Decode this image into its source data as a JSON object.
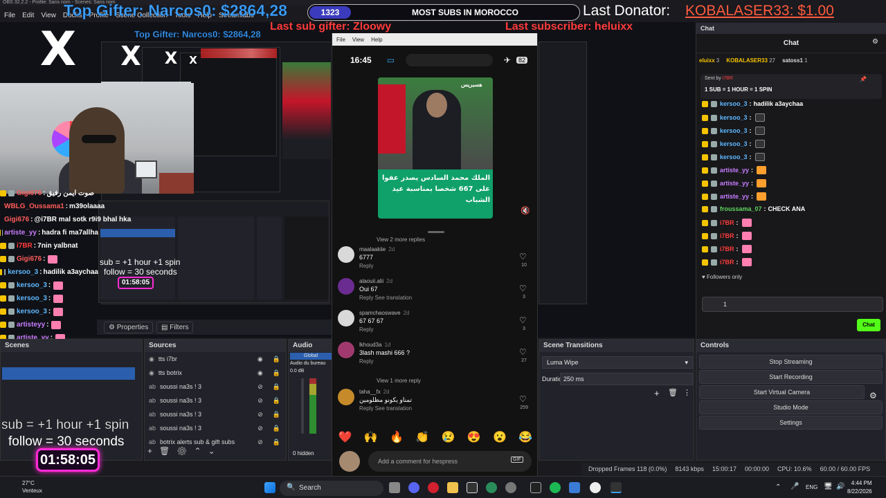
{
  "obs": {
    "window_title": "OBS 32.2.2 - Profile: Sans nom - Scenes: Sans nom",
    "menu": [
      "File",
      "Edit",
      "View",
      "Docks",
      "Profile",
      "Scene Collection",
      "Tools",
      "Help",
      "Streamlabs"
    ]
  },
  "overlay": {
    "top_gifter": "Top Gifter: Narcos0: $2864,28",
    "sub_goal_count": "1323",
    "sub_goal_label": "MOST SUBS IN MOROCCO",
    "last_donator_label": "Last Donator:",
    "last_donator_value": "KOBALASER33: $1.00",
    "last_sub_gifter": "Last sub gifter: Zloowy",
    "last_subscriber": "Last subscriber: heluixx",
    "sub_rule": "sub  = +1 hour +1 spin",
    "follow_rule": "follow = 30 seconds",
    "timer": "01:58:05",
    "logo": "X"
  },
  "left_chat": [
    {
      "user": "Gigi676",
      "text": "صوت ايمن رفيق",
      "color": "#ff5c5c"
    },
    {
      "user": "WBLG_Oussama1",
      "text": "m39olaaaa",
      "color": "#ff5c5c"
    },
    {
      "user": "Gigi676",
      "text": "@i7BR mal sotk r9i9 bhal hka",
      "color": "#ff5c5c"
    },
    {
      "user": "artiste_yy",
      "text": "hadra fi ma7allha",
      "color": "#c97dff"
    },
    {
      "user": "i7BR",
      "text": "7nin yalbnat",
      "color": "#ff3b3b"
    },
    {
      "user": "Gigi676",
      "text": "",
      "color": "#ff5c5c"
    },
    {
      "user": "kersoo_3",
      "text": "hadilik a3aychaa",
      "color": "#5fb8ff"
    },
    {
      "user": "kersoo_3",
      "text": "",
      "color": "#5fb8ff"
    },
    {
      "user": "kersoo_3",
      "text": "",
      "color": "#5fb8ff"
    },
    {
      "user": "kersoo_3",
      "text": "",
      "color": "#5fb8ff"
    },
    {
      "user": "artisteyy",
      "text": "",
      "color": "#c97dff"
    },
    {
      "user": "artiste_yy",
      "text": "",
      "color": "#c97dff"
    },
    {
      "user": "artiste_yy",
      "text": "",
      "color": "#c97dff"
    },
    {
      "user": "froussama_07",
      "text": "CHECK ANA",
      "color": "#5fd35f"
    },
    {
      "user": "i7BR",
      "text": "",
      "color": "#ff3b3b"
    },
    {
      "user": "i7BR",
      "text": "",
      "color": "#ff3b3b"
    },
    {
      "user": "i7BR",
      "text": "",
      "color": "#ff3b3b"
    },
    {
      "user": "i7BR",
      "text": "",
      "color": "#ff3b3b"
    }
  ],
  "docks": {
    "scenes_title": "Scenes",
    "sources_title": "Sources",
    "audio_title": "Audio Mixer",
    "audio_global": "Global",
    "audio_device": "Audio du bureau",
    "audio_db": "0.0 dB",
    "audio_hidden": "0 hidden",
    "transitions_title": "Scene Transitions",
    "transition_value": "Luma Wipe",
    "duration_label": "Duration",
    "duration_value": "250 ms",
    "controls_title": "Controls",
    "properties": "Properties",
    "filters": "Filters",
    "controls": [
      "Stop Streaming",
      "Start Recording",
      "Start Virtual Camera",
      "Studio Mode",
      "Settings"
    ],
    "sources": [
      "tts i7br",
      "tts botrix",
      "soussi na3s ! 3",
      "soussi na3s ! 3",
      "soussi na3s ! 3",
      "soussi na3s ! 3",
      "botrix alerts sub & gift subs"
    ]
  },
  "phone": {
    "menu": [
      "File",
      "View",
      "Help"
    ],
    "time": "16:45",
    "battery": "82",
    "news_logo": "هسبريس",
    "news_caption": "الملك محمد السادس يصدر عفوا على 667 شخصا بمناسبة عيد الشباب",
    "view_more_2": "View 2 more replies",
    "view_more_1": "View 1 more reply",
    "comments": [
      {
        "user": "maalaakiie",
        "age": "2d",
        "text": "6777",
        "meta": "Reply",
        "likes": "10"
      },
      {
        "user": "alaouii.alii",
        "age": "2d",
        "text": "Oui 67",
        "meta": "Reply    See translation",
        "likes": "3"
      },
      {
        "user": "spamchaoswave",
        "age": "2d",
        "text": "67 67 67",
        "meta": "Reply",
        "likes": "3"
      },
      {
        "user": "lkhoud3a",
        "age": "1d",
        "text": "3lash mashi 666 ?",
        "meta": "Reply",
        "likes": "27"
      },
      {
        "user": "taha__fx",
        "age": "2d",
        "text": "تمناو يكونو مظلومين",
        "meta": "Reply    See translation",
        "likes": "259"
      }
    ],
    "comment_placeholder": "Add a comment for hespress",
    "gif": "GIF"
  },
  "right_chat": {
    "dock_title": "Chat",
    "header": "Chat",
    "top_users": [
      "eluixx",
      "KOBALASER33",
      "satoss1"
    ],
    "top_counts": [
      "3",
      "27",
      "1"
    ],
    "pinned_label": "Sent by",
    "pinned_user": "i7BR",
    "pinned_text": "1 SUB = 1 HOUR = 1 SPIN",
    "messages": [
      {
        "user": "kersoo_3",
        "text": "hadilik a3aychaa",
        "color": "#5fb8ff"
      },
      {
        "user": "kersoo_3",
        "text": "",
        "color": "#5fb8ff"
      },
      {
        "user": "kersoo_3",
        "text": "",
        "color": "#5fb8ff"
      },
      {
        "user": "kersoo_3",
        "text": "",
        "color": "#5fb8ff"
      },
      {
        "user": "kersoo_3",
        "text": "",
        "color": "#5fb8ff"
      },
      {
        "user": "artiste_yy",
        "text": "",
        "color": "#c97dff"
      },
      {
        "user": "artiste_yy",
        "text": "",
        "color": "#c97dff"
      },
      {
        "user": "artiste_yy",
        "text": "",
        "color": "#c97dff"
      },
      {
        "user": "froussama_07",
        "text": "CHECK ANA",
        "color": "#5fd35f"
      },
      {
        "user": "i7BR",
        "text": "",
        "color": "#ff3b3b"
      },
      {
        "user": "i7BR",
        "text": "",
        "color": "#ff3b3b"
      },
      {
        "user": "i7BR",
        "text": "",
        "color": "#ff3b3b"
      },
      {
        "user": "i7BR",
        "text": "",
        "color": "#ff3b3b"
      }
    ],
    "followers_only": "Followers only",
    "input_value": "1",
    "send_label": "Chat",
    "accent": "#53fc18"
  },
  "status_bar": {
    "dropped": "Dropped Frames 118 (0.0%)",
    "bitrate": "8143 kbps",
    "stream_time": "15:00:17",
    "rec_time": "00:00:00",
    "cpu": "CPU: 10.6%",
    "fps": "60.00 / 60.00 FPS"
  },
  "taskbar": {
    "weather_temp": "27°C",
    "weather_desc": "Venteux",
    "search": "Search",
    "lang": "ENG",
    "time": "4:44 PM",
    "date": "8/22/2026"
  }
}
